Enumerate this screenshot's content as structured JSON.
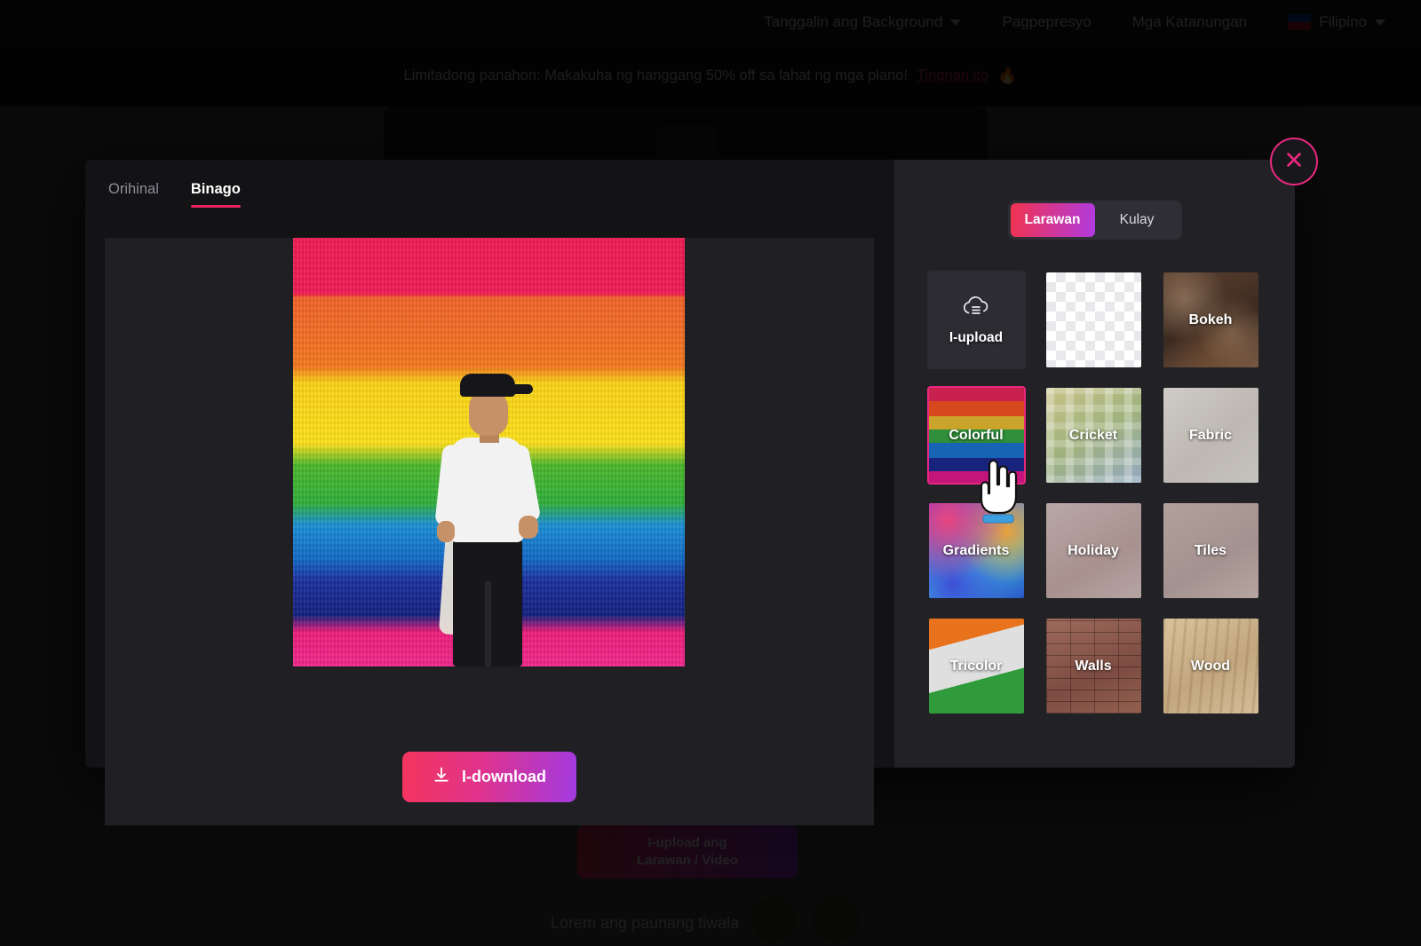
{
  "background_page": {
    "nav": [
      {
        "label": "Tanggalin ang Background",
        "icon": "chevron-down-icon"
      },
      {
        "label": "Pagpepresyo"
      },
      {
        "label": "Mga Katanungan"
      },
      {
        "label": "Filipino",
        "icon": "flag-icon"
      }
    ],
    "banner": {
      "text": "Limitadong panahon: Makakuha ng hanggang 50% off sa lahat ng mga plano!",
      "link": "Tingnan ito",
      "emoji": "🔥"
    },
    "cta": {
      "line1": "I-upload ang",
      "line2": "Larawan / Video"
    },
    "footnote": "Lorem ang paunang tiwala"
  },
  "modal": {
    "tabs": [
      {
        "label": "Orihinal",
        "active": false
      },
      {
        "label": "Binago",
        "active": true
      }
    ],
    "close_icon": "close-icon",
    "download": {
      "label": "I-download",
      "icon": "download-icon"
    },
    "segmented": [
      {
        "label": "Larawan",
        "active": true
      },
      {
        "label": "Kulay",
        "active": false
      }
    ],
    "backgrounds": [
      {
        "label": "I-upload",
        "icon": "cloud-upload-icon",
        "kind": "upload",
        "selected": false
      },
      {
        "label": "",
        "kind": "transparent",
        "selected": false
      },
      {
        "label": "Bokeh",
        "kind": "bokeh",
        "selected": false
      },
      {
        "label": "Colorful",
        "kind": "colorful",
        "selected": true
      },
      {
        "label": "Cricket",
        "kind": "cricket",
        "selected": false
      },
      {
        "label": "Fabric",
        "kind": "fabric",
        "selected": false
      },
      {
        "label": "Gradients",
        "kind": "gradients",
        "selected": false
      },
      {
        "label": "Holiday",
        "kind": "holiday",
        "selected": false
      },
      {
        "label": "Tiles",
        "kind": "tiles",
        "selected": false
      },
      {
        "label": "Tricolor",
        "kind": "tricolor",
        "selected": false
      },
      {
        "label": "Walls",
        "kind": "walls",
        "selected": false
      },
      {
        "label": "Wood",
        "kind": "wood",
        "selected": false
      }
    ]
  },
  "colors": {
    "accent_pink": "#e8277f",
    "gradient_start": "#f4355d",
    "gradient_end": "#a23ae0",
    "panel_dark": "#131316",
    "panel_light": "#222226",
    "cursor_bar": "#3d9fe0"
  }
}
